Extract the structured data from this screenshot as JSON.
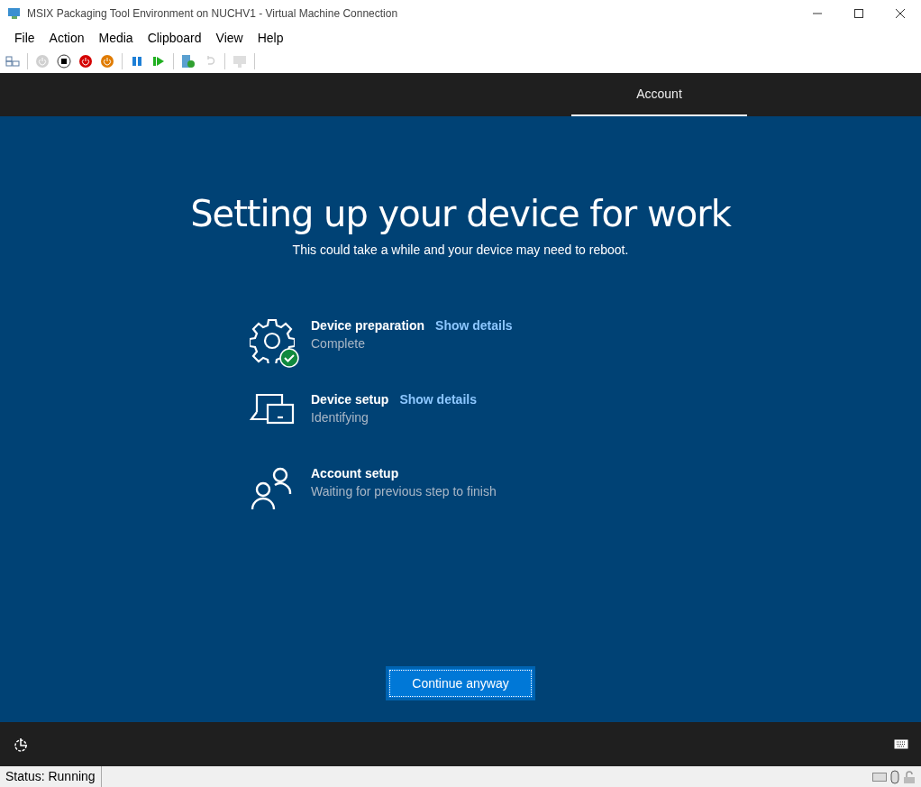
{
  "window": {
    "title": "MSIX Packaging Tool Environment on NUCHV1 - Virtual Machine Connection"
  },
  "menu": [
    "File",
    "Action",
    "Media",
    "Clipboard",
    "View",
    "Help"
  ],
  "toolbar": [
    {
      "kind": "ctrl-alt-del",
      "disabled": false
    },
    {
      "kind": "sep"
    },
    {
      "kind": "start",
      "disabled": true
    },
    {
      "kind": "turn-off",
      "disabled": false
    },
    {
      "kind": "shutdown",
      "disabled": false
    },
    {
      "kind": "save",
      "disabled": false
    },
    {
      "kind": "sep"
    },
    {
      "kind": "pause",
      "disabled": false
    },
    {
      "kind": "resume",
      "disabled": false
    },
    {
      "kind": "sep"
    },
    {
      "kind": "checkpoint",
      "disabled": false
    },
    {
      "kind": "revert",
      "disabled": true
    },
    {
      "kind": "sep"
    },
    {
      "kind": "enhanced",
      "disabled": true
    },
    {
      "kind": "sep"
    }
  ],
  "oobe_tabs": [
    {
      "label": "Account",
      "selected": true
    }
  ],
  "heading": "Setting up your device for work",
  "subheading": "This could take a while and your device may need to reboot.",
  "steps": [
    {
      "kind": "gear",
      "title": "Device preparation",
      "link": "Show details",
      "status": "Complete",
      "complete": true
    },
    {
      "kind": "devices",
      "title": "Device setup",
      "link": "Show details",
      "status": "Identifying",
      "complete": false
    },
    {
      "kind": "people",
      "title": "Account setup",
      "status": "Waiting for previous step to finish",
      "complete": false
    }
  ],
  "continue_button": "Continue anyway",
  "status_bar": {
    "status": "Status: Running"
  }
}
